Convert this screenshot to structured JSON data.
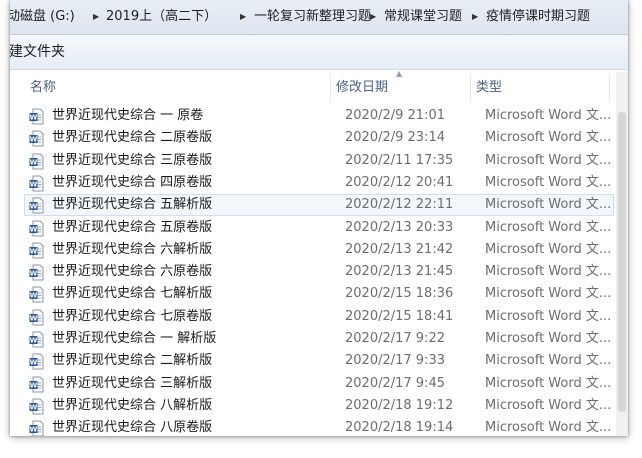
{
  "breadcrumb": [
    {
      "label": "移动磁盘 (G:)"
    },
    {
      "label": "2019上（高二下）"
    },
    {
      "label": "一轮复习新整理习题"
    },
    {
      "label": "常规课堂习题"
    },
    {
      "label": "疫情停课时期习题"
    }
  ],
  "toolbar": {
    "new_folder_label": "新建文件夹"
  },
  "columns": {
    "name": "名称",
    "date": "修改日期",
    "type": "类型"
  },
  "colors": {
    "selection": "#cddff4",
    "header_text": "#4d6185",
    "word_icon": "#2b5797"
  },
  "files": [
    {
      "name": "世界近现代史综合 一 原卷",
      "date": "2020/2/9 21:01",
      "type": "Microsoft Word 文...",
      "icon": "word-document-icon"
    },
    {
      "name": "世界近现代史综合 二原卷版",
      "date": "2020/2/9 23:14",
      "type": "Microsoft Word 文...",
      "icon": "word-document-icon"
    },
    {
      "name": "世界近现代史综合 三原卷版",
      "date": "2020/2/11 17:35",
      "type": "Microsoft Word 文...",
      "icon": "word-document-icon"
    },
    {
      "name": "世界近现代史综合 四原卷版",
      "date": "2020/2/12 20:41",
      "type": "Microsoft Word 文...",
      "icon": "word-document-icon"
    },
    {
      "name": "世界近现代史综合 五解析版",
      "date": "2020/2/12 22:11",
      "type": "Microsoft Word 文...",
      "icon": "word-document-icon",
      "selected": true
    },
    {
      "name": "世界近现代史综合 五原卷版",
      "date": "2020/2/13 20:33",
      "type": "Microsoft Word 文...",
      "icon": "word-document-icon"
    },
    {
      "name": "世界近现代史综合 六解析版",
      "date": "2020/2/13 21:42",
      "type": "Microsoft Word 文...",
      "icon": "word-document-icon"
    },
    {
      "name": "世界近现代史综合 六原卷版",
      "date": "2020/2/13 21:45",
      "type": "Microsoft Word 文...",
      "icon": "word-document-icon"
    },
    {
      "name": "世界近现代史综合 七解析版",
      "date": "2020/2/15 18:36",
      "type": "Microsoft Word 文...",
      "icon": "word-document-icon"
    },
    {
      "name": "世界近现代史综合 七原卷版",
      "date": "2020/2/15 18:41",
      "type": "Microsoft Word 文...",
      "icon": "word-document-icon"
    },
    {
      "name": "世界近现代史综合 一 解析版",
      "date": "2020/2/17 9:22",
      "type": "Microsoft Word 文...",
      "icon": "word-document-icon"
    },
    {
      "name": "世界近现代史综合 二解析版",
      "date": "2020/2/17 9:33",
      "type": "Microsoft Word 文...",
      "icon": "word-document-icon"
    },
    {
      "name": "世界近现代史综合 三解析版",
      "date": "2020/2/17 9:45",
      "type": "Microsoft Word 文...",
      "icon": "word-document-icon"
    },
    {
      "name": "世界近现代史综合 八解析版",
      "date": "2020/2/18 19:12",
      "type": "Microsoft Word 文...",
      "icon": "word-document-icon"
    },
    {
      "name": "世界近现代史综合 八原卷版",
      "date": "2020/2/18 19:14",
      "type": "Microsoft Word 文...",
      "icon": "word-document-icon"
    }
  ]
}
